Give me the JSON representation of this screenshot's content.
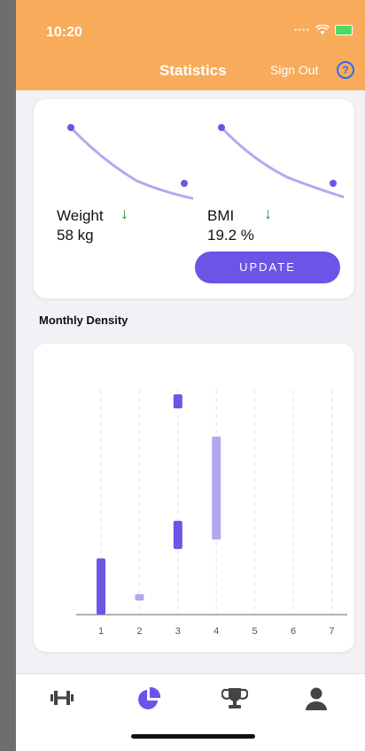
{
  "status_bar": {
    "time": "10:20"
  },
  "header": {
    "title": "Statistics",
    "sign_out_label": "Sign Out",
    "help_icon": "question-circle-icon",
    "color": "#f8ab5a"
  },
  "metrics": [
    {
      "label": "Weight",
      "value": "58 kg",
      "trend": "down-arrow-icon",
      "trend_color": "#1e8f34"
    },
    {
      "label": "BMI",
      "value": "19.2 %",
      "trend": "down-arrow-icon",
      "trend_color": "#1e8f34"
    }
  ],
  "update_button": {
    "label": "UPDATE",
    "color": "#6a55e6"
  },
  "density_section": {
    "title": "Monthly Density"
  },
  "chart_data": {
    "type": "bar",
    "subtype": "range-bar",
    "x": [
      1,
      2,
      3,
      4,
      5,
      6,
      7
    ],
    "tick_labels": [
      "1",
      "2",
      "3",
      "4",
      "5",
      "6",
      "7"
    ],
    "ylim": [
      0,
      24
    ],
    "grid": "vertical-dashed",
    "series": [
      {
        "color": "#6a55e6",
        "ranges": [
          {
            "x": 1,
            "low": 0,
            "high": 6
          },
          {
            "x": 3,
            "low": 7,
            "high": 10
          },
          {
            "x": 3,
            "low": 22,
            "high": 23.5
          }
        ]
      },
      {
        "color": "#b3a8f0",
        "ranges": [
          {
            "x": 2,
            "low": 1.5,
            "high": 2.2
          },
          {
            "x": 4,
            "low": 8,
            "high": 19
          }
        ]
      }
    ]
  },
  "tabs": [
    {
      "icon": "dumbbell-icon",
      "active": false
    },
    {
      "icon": "pie-chart-icon",
      "active": true
    },
    {
      "icon": "trophy-icon",
      "active": false
    },
    {
      "icon": "user-icon",
      "active": false
    }
  ],
  "colors": {
    "accent": "#6a55e6",
    "line": "#b3a8f0",
    "tab_icon": "#444444",
    "tab_active": "#6a55e6"
  }
}
